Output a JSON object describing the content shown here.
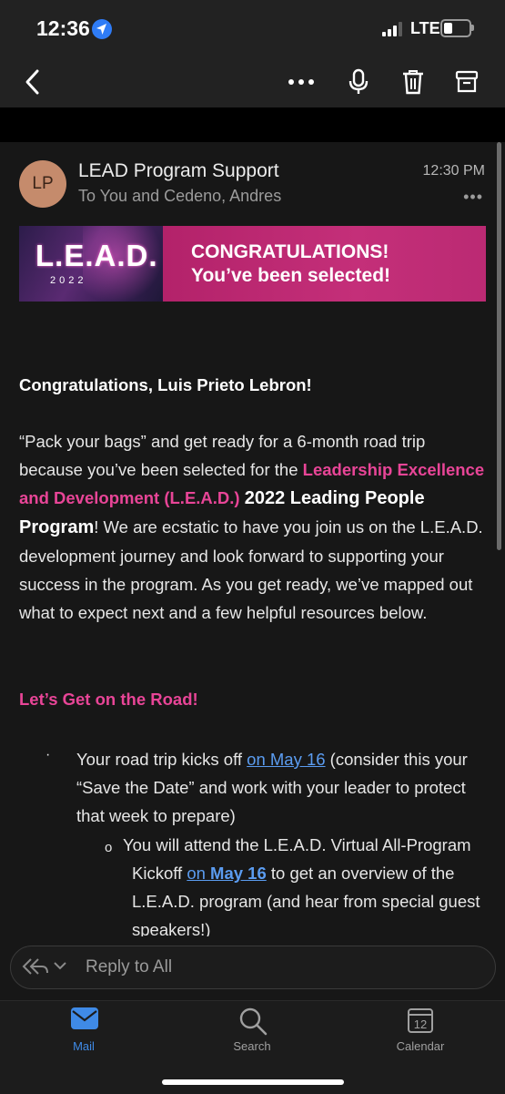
{
  "status_bar": {
    "time": "12:36",
    "network": "LTE"
  },
  "colors": {
    "accent_pink": "#e84597",
    "link_blue": "#5b9cf0",
    "mail_blue": "#3f8ae6"
  },
  "icons": {
    "back": "chevron-left-icon",
    "more": "more-horizontal-icon",
    "mic": "microphone-icon",
    "delete": "trash-icon",
    "archive": "archive-icon",
    "location": "location-arrow-icon",
    "signal": "cellular-signal-icon",
    "battery": "battery-icon",
    "reply": "reply-all-icon",
    "mail": "mail-icon",
    "search": "search-icon",
    "calendar": "calendar-icon"
  },
  "email": {
    "avatar_initials": "LP",
    "sender": "LEAD Program Support",
    "recipients": "To You and Cedeno, Andres",
    "time": "12:30 PM",
    "more": "•••",
    "banner": {
      "logo": "L.E.A.D.",
      "year": "2022",
      "line1": "CONGRATULATIONS!",
      "line2": "You’ve been selected!"
    },
    "greeting": "Congratulations, Luis Prieto Lebron!",
    "para": {
      "t1": "“Pack your bags” and get ready for a 6-month road trip because you’ve been selected for the ",
      "program_name": "Leadership Excellence and Development (L.E.A.D.)",
      "t2": " ",
      "program_year": "2022 Leading People Program",
      "t3": "! We are ecstatic to have you join us on the L.E.A.D. development journey and look forward to supporting your success in the program.  As you get ready, we’ve mapped out what to expect next and a few helpful resources below."
    },
    "section_heading": "Let’s Get on the Road!",
    "bullet_symbol": "·",
    "bullet1": {
      "t1": "Your road trip kicks off ",
      "link": "on May 16",
      "t2": " (consider this your “Save the Date” and work with your leader to protect that week to prepare)"
    },
    "sub_bullet_symbol": "o",
    "sub_bullet": {
      "t1": "You will attend the L.E.A.D. Virtual All-Program Kickoff ",
      "link1": "on ",
      "link2": "May 16",
      "t2": " to get an overview of the L.E.A.D. program (and hear from special guest speakers!)"
    }
  },
  "reply": {
    "placeholder": "Reply to All"
  },
  "nav": {
    "mail": "Mail",
    "search": "Search",
    "calendar": "Calendar",
    "calendar_day": "12"
  }
}
